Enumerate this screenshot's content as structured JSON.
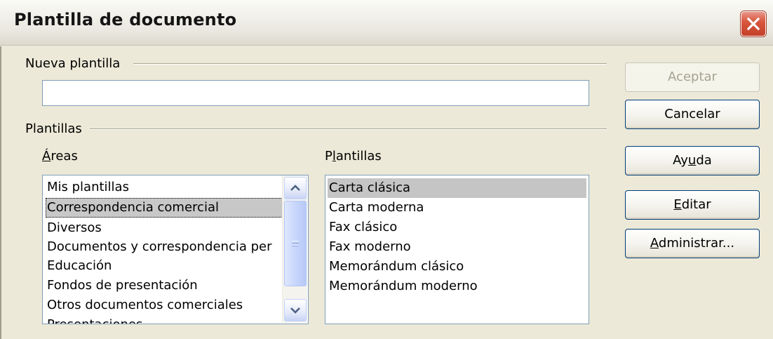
{
  "window": {
    "title": "Plantilla de documento"
  },
  "new_template": {
    "group_label": "Nueva plantilla",
    "name_value": ""
  },
  "templates": {
    "group_label": "Plantillas",
    "areas_label_accel": "Á",
    "areas_label_rest": "reas",
    "templates_label_pre": "P",
    "templates_label_accel": "l",
    "templates_label_post": "antillas",
    "areas": [
      "Mis plantillas",
      "Correspondencia comercial",
      "Diversos",
      "Documentos y correspondencia per",
      "Educación",
      "Fondos de presentación",
      "Otros documentos comerciales",
      "Presentaciones"
    ],
    "selected_area": "Correspondencia comercial",
    "template_items": [
      "Carta clásica",
      "Carta moderna",
      "Fax clásico",
      "Fax moderno",
      "Memorándum clásico",
      "Memorándum moderno"
    ],
    "selected_template": "Carta clásica"
  },
  "buttons": {
    "accept": "Aceptar",
    "cancel": "Cancelar",
    "help_pre": "Ay",
    "help_accel": "u",
    "help_post": "da",
    "edit_accel": "E",
    "edit_post": "ditar",
    "manage_accel": "A",
    "manage_post": "dministrar..."
  },
  "icons": {
    "close": "close-x-icon",
    "scroll_up": "chevron-up-icon",
    "scroll_down": "chevron-down-icon"
  }
}
